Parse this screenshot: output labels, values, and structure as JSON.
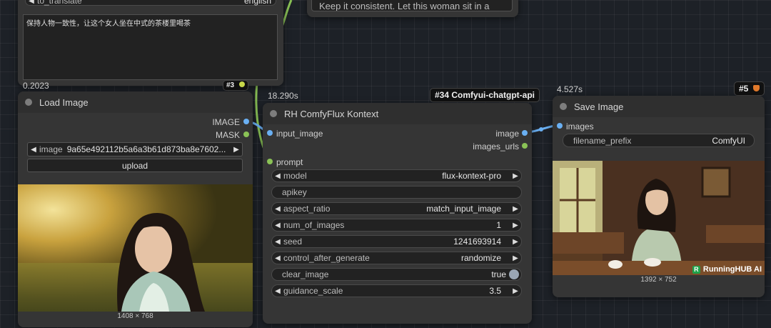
{
  "translate_node": {
    "text_to_translate": "保持人物一致性，让这个女人坐在中式的茶楼里喝茶",
    "partial_widget_name": "to_translate",
    "partial_widget_value": "english",
    "timing": "0.2023",
    "badge": "#3"
  },
  "prompt_preview_node": {
    "text": "Keep it consistent. Let this woman sit in a"
  },
  "load_image_node": {
    "title": "Load Image",
    "outputs": [
      "IMAGE",
      "MASK"
    ],
    "image_widget": {
      "name": "image",
      "value": "9a65e492112b5a6a3b61d873ba8e7602..."
    },
    "upload_label": "upload",
    "image_size": "1408 × 768"
  },
  "flux_node": {
    "timing": "18.290s",
    "badge": "#34 Comfyui-chatgpt-api",
    "title": "RH ComfyFlux Kontext",
    "inputs": [
      "input_image",
      "prompt"
    ],
    "outputs": [
      "image",
      "images_urls"
    ],
    "widgets": [
      {
        "name": "model",
        "value": "flux-kontext-pro"
      },
      {
        "name": "apikey",
        "value": ""
      },
      {
        "name": "aspect_ratio",
        "value": "match_input_image"
      },
      {
        "name": "num_of_images",
        "value": "1"
      },
      {
        "name": "seed",
        "value": "1241693914"
      },
      {
        "name": "control_after_generate",
        "value": "randomize"
      },
      {
        "name": "clear_image",
        "value": "true"
      },
      {
        "name": "guidance_scale",
        "value": "3.5"
      }
    ]
  },
  "save_image_node": {
    "timing": "4.527s",
    "badge": "#5",
    "title": "Save Image",
    "input": "images",
    "filename_prefix": {
      "name": "filename_prefix",
      "value": "ComfyUI"
    },
    "watermark": "RunningHUB AI",
    "image_size": "1392 × 752"
  },
  "colors": {
    "image_link": "#6ab0f3",
    "prompt_link": "#8ac256",
    "node_bg": "#353535",
    "canvas_bg": "#1d2127"
  }
}
